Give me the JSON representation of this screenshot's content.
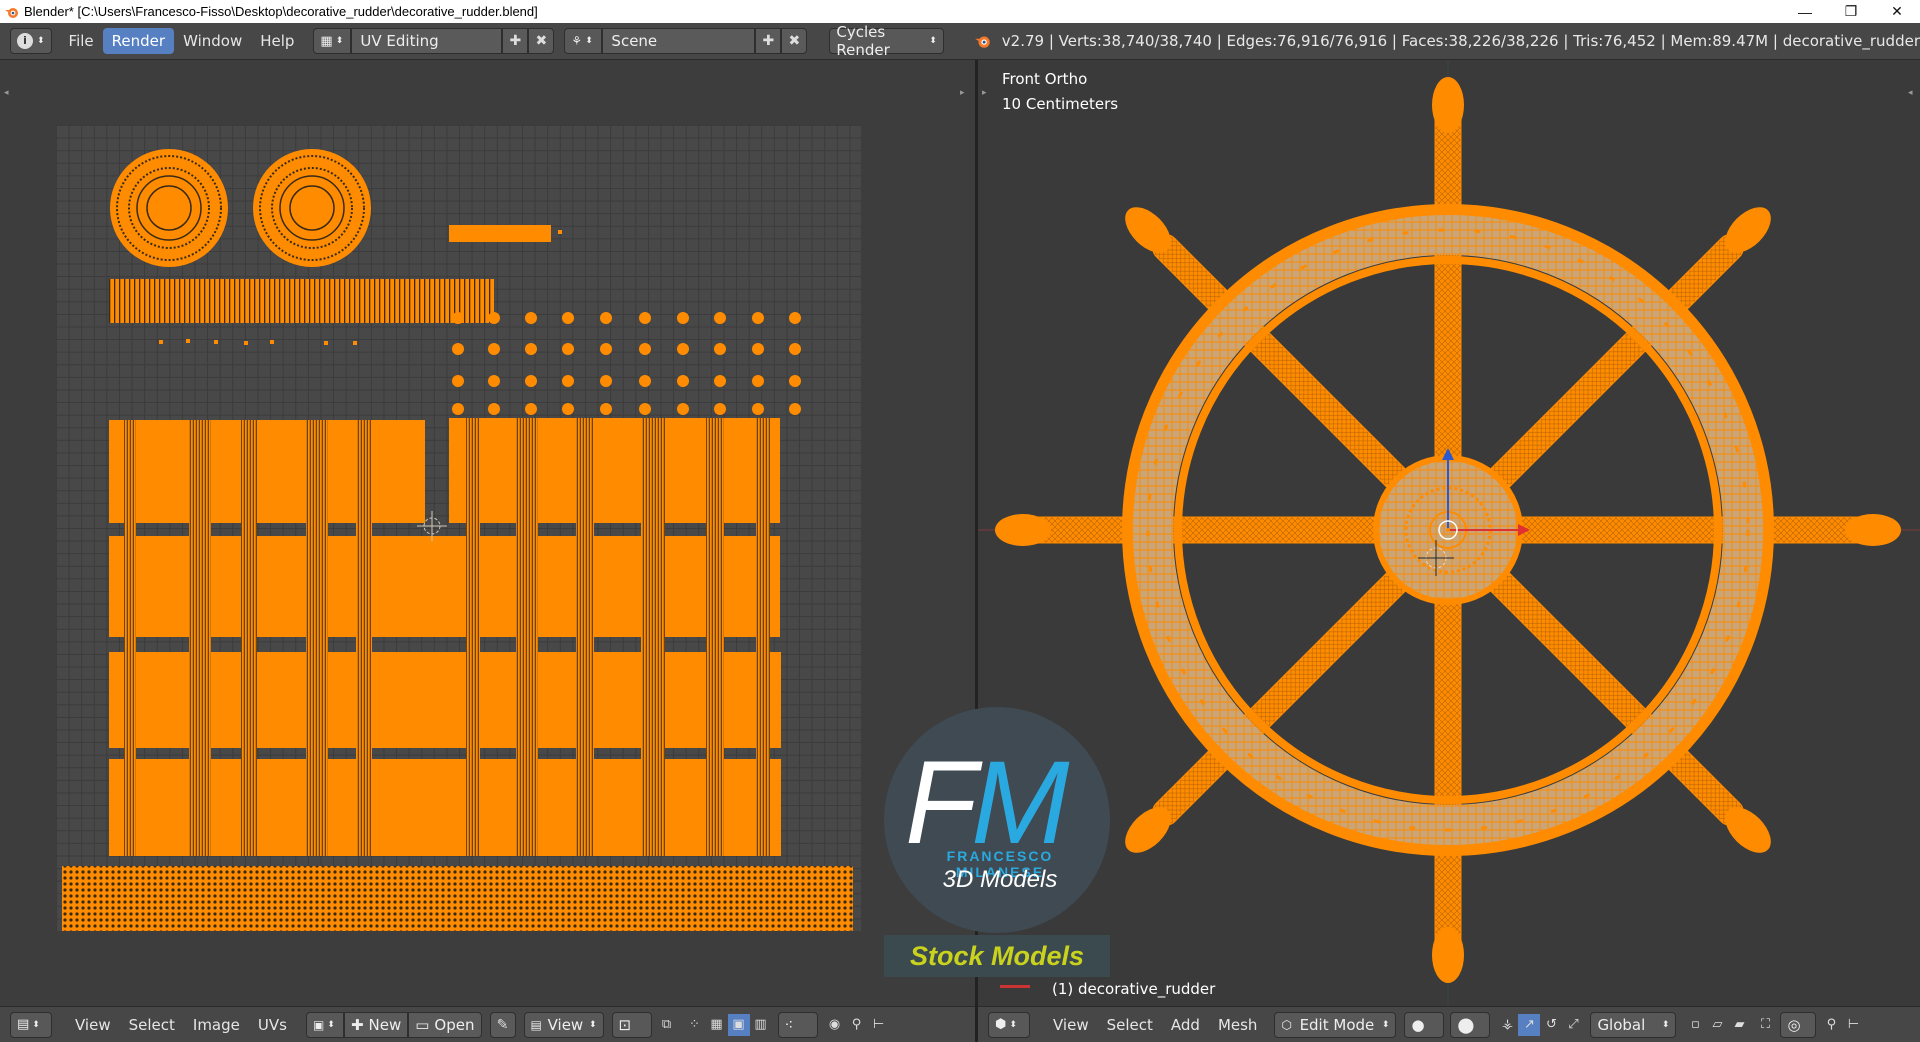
{
  "window": {
    "title": "Blender* [C:\\Users\\Francesco-Fisso\\Desktop\\decorative_rudder\\decorative_rudder.blend]",
    "minimize": "—",
    "maximize": "❐",
    "close": "✕"
  },
  "info_header": {
    "menus": [
      "File",
      "Render",
      "Window",
      "Help"
    ],
    "active_menu": "Render",
    "screen_layout": "UV Editing",
    "scene": "Scene",
    "render_engine": "Cycles Render",
    "stats": "v2.79 | Verts:38,740/38,740 | Edges:76,916/76,916 | Faces:38,226/38,226 | Tris:76,452 | Mem:89.47M | decorative_rudder"
  },
  "viewport": {
    "view_name": "Front Ortho",
    "scale": "10 Centimeters",
    "object_label": "(1) decorative_rudder"
  },
  "logo": {
    "letters_f": "F",
    "letters_m": "M",
    "name": "FRANCESCO MILANESE",
    "subtitle": "3D Models",
    "badge": "Stock Models"
  },
  "uv_footer": {
    "menus": [
      "View",
      "Select",
      "Image",
      "UVs"
    ],
    "new_label": "New",
    "open_label": "Open",
    "view_label": "View"
  },
  "view3d_footer": {
    "menus": [
      "View",
      "Select",
      "Add",
      "Mesh"
    ],
    "mode": "Edit Mode",
    "orientation": "Global"
  },
  "colors": {
    "accent_blue": "#5680c2",
    "uv_orange": "#ff8c00",
    "logo_blue": "#2aa9e0",
    "logo_green": "#c9d21d"
  }
}
